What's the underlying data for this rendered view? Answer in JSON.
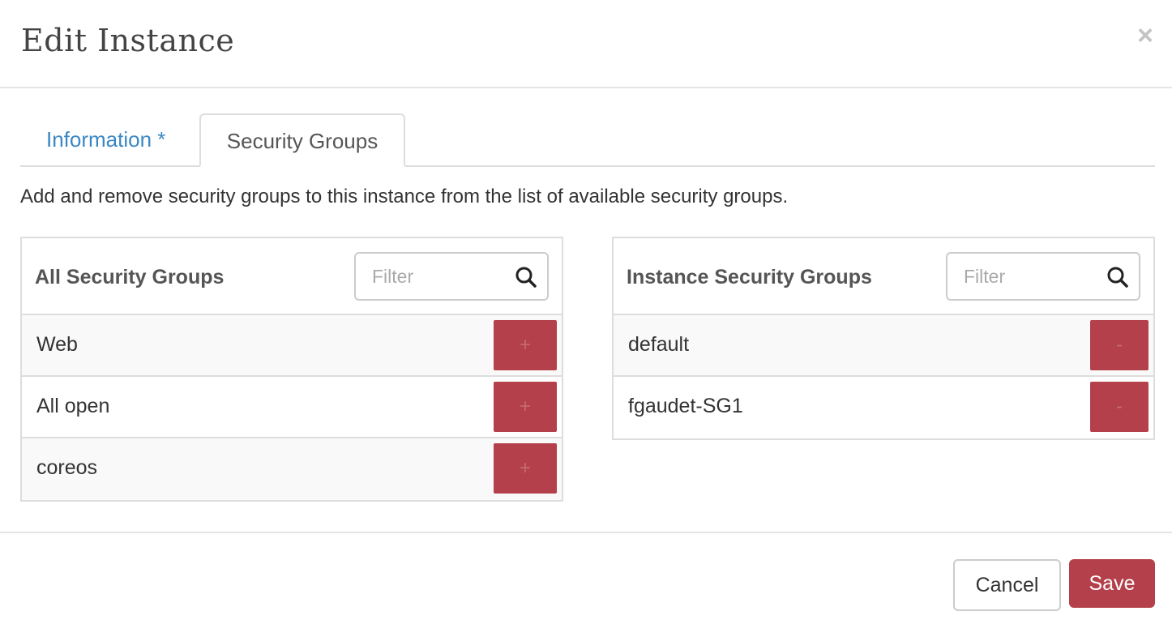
{
  "modal": {
    "title": "Edit Instance",
    "close_glyph": "×"
  },
  "tabs": [
    {
      "label": "Information *",
      "active": false
    },
    {
      "label": "Security Groups",
      "active": true
    }
  ],
  "help_text": "Add and remove security groups to this instance from the list of available security groups.",
  "available": {
    "title": "All Security Groups",
    "filter_placeholder": "Filter",
    "filter_value": "",
    "items": [
      {
        "label": "Web",
        "action": "+"
      },
      {
        "label": "All open",
        "action": "+"
      },
      {
        "label": "coreos",
        "action": "+"
      }
    ]
  },
  "assigned": {
    "title": "Instance Security Groups",
    "filter_placeholder": "Filter",
    "filter_value": "",
    "items": [
      {
        "label": "default",
        "action": "-"
      },
      {
        "label": "fgaudet-SG1",
        "action": "-"
      }
    ]
  },
  "footer": {
    "cancel_label": "Cancel",
    "save_label": "Save"
  },
  "colors": {
    "accent": "#b3404a",
    "link": "#3a87c4",
    "border": "#dddddd"
  },
  "icons": {
    "close": "close-icon",
    "search": "search-icon"
  }
}
